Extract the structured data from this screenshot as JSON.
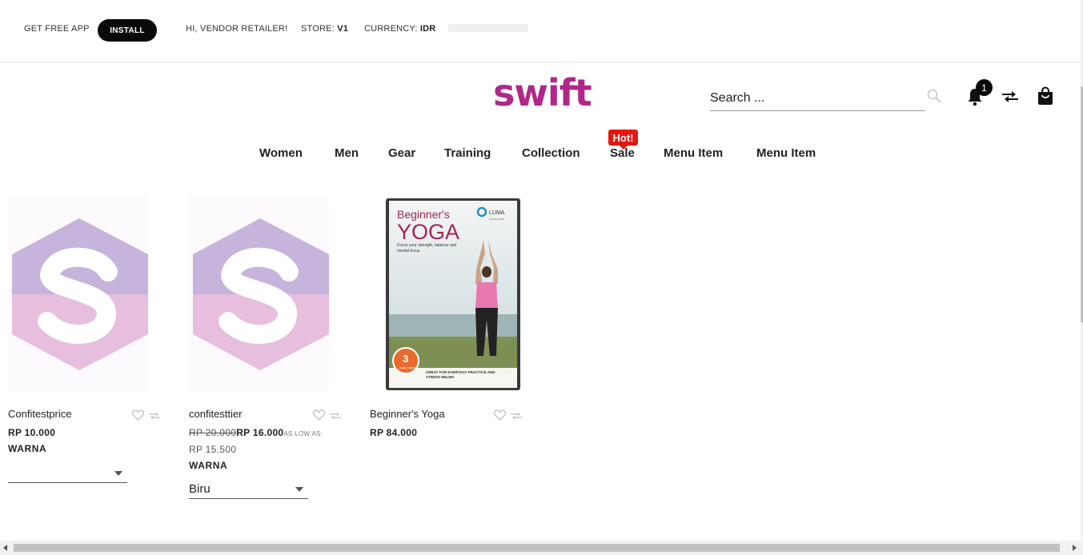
{
  "topbar": {
    "get_app": "GET FREE APP",
    "install_label": "INSTALL",
    "greeting": "HI, VENDOR RETAILER!",
    "store_label": "STORE:",
    "store_value": "V1",
    "currency_label": "CURRENCY:",
    "currency_value": "IDR"
  },
  "header": {
    "logo": "swift",
    "search_placeholder": "Search ...",
    "notification_count": "1",
    "brand_color": "#b0278a"
  },
  "nav": {
    "items": [
      "Women",
      "Men",
      "Gear",
      "Training",
      "Collection",
      "Sale",
      "Menu Item",
      "Menu Item"
    ],
    "hot_badge": "Hot!"
  },
  "products": [
    {
      "name": "Confitestprice",
      "price": "RP 10.000",
      "attribute_label": "WARNA",
      "selected_option": ""
    },
    {
      "name": "confitesttier",
      "old_price": "RP 20.000",
      "price": "RP 16.000",
      "as_low_as_label": "AS LOW AS:",
      "as_low_as_price": "RP 15.500",
      "attribute_label": "WARNA",
      "selected_option": "Biru"
    },
    {
      "name": "Beginner's Yoga",
      "price": "RP 84.000",
      "cover": {
        "title_line1": "Beginner's",
        "title_line2": "YOGA",
        "brand": "LUMA",
        "brand_sub": "Fitness Studio",
        "tagline": "Focus your strength, balance and mental focus",
        "badge_number": "3",
        "badge_text": "yoga programs",
        "footer": "GREAT FOR EVERYDAY PRACTICE AND STRESS RELIEF."
      }
    }
  ]
}
